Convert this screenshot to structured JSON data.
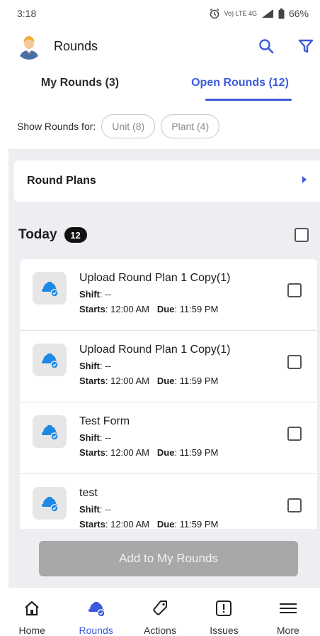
{
  "status_bar": {
    "time": "3:18",
    "network": "Vo) LTE 4G",
    "battery": "66%"
  },
  "header": {
    "title": "Rounds"
  },
  "tabs": [
    {
      "label": "My Rounds (3)",
      "active": false
    },
    {
      "label": "Open Rounds (12)",
      "active": true
    }
  ],
  "filters": {
    "label": "Show Rounds for:",
    "chips": [
      "Unit (8)",
      "Plant (4)"
    ]
  },
  "round_plans": {
    "label": "Round Plans"
  },
  "today": {
    "label": "Today",
    "count": "12"
  },
  "rounds": [
    {
      "title": "Upload Round Plan 1 Copy(1)",
      "shift_label": "Shift",
      "shift_value": ": --",
      "starts_label": "Starts",
      "starts_value": ": 12:00 AM",
      "due_label": "Due",
      "due_value": ": 11:59 PM"
    },
    {
      "title": "Upload Round Plan 1 Copy(1)",
      "shift_label": "Shift",
      "shift_value": ": --",
      "starts_label": "Starts",
      "starts_value": ": 12:00 AM",
      "due_label": "Due",
      "due_value": ": 11:59 PM"
    },
    {
      "title": "Test Form",
      "shift_label": "Shift",
      "shift_value": ": --",
      "starts_label": "Starts",
      "starts_value": ": 12:00 AM",
      "due_label": "Due",
      "due_value": ": 11:59 PM"
    },
    {
      "title": "test",
      "shift_label": "Shift",
      "shift_value": ": --",
      "starts_label": "Starts",
      "starts_value": ": 12:00 AM",
      "due_label": "Due",
      "due_value": ": 11:59 PM"
    }
  ],
  "add_button": {
    "label": "Add to My Rounds"
  },
  "bottom_nav": [
    {
      "label": "Home",
      "icon": "home-icon",
      "active": false
    },
    {
      "label": "Rounds",
      "icon": "hardhat-icon",
      "active": true
    },
    {
      "label": "Actions",
      "icon": "tag-icon",
      "active": false
    },
    {
      "label": "Issues",
      "icon": "alert-icon",
      "active": false
    },
    {
      "label": "More",
      "icon": "menu-icon",
      "active": false
    }
  ],
  "colors": {
    "accent": "#3b5bdb",
    "icon_blue": "#2196f3",
    "disabled_button": "#a8a8a8",
    "panel_bg": "#eceef1"
  }
}
